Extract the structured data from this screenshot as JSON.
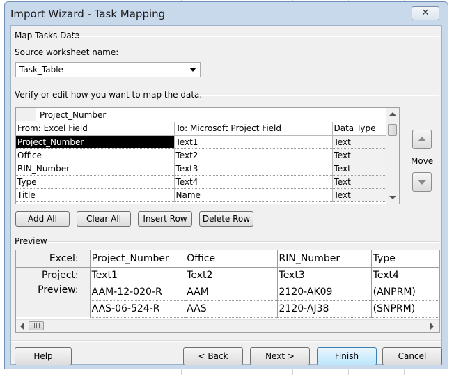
{
  "window": {
    "title": "Import Wizard - Task Mapping",
    "close_label": "✕"
  },
  "section": {
    "heading": "Map Tasks Data",
    "source_label": "Source worksheet name:",
    "source_value": "Task_Table",
    "verify_label": "Verify or edit how you want to map the data."
  },
  "mapping": {
    "edit_value": "Project_Number",
    "headers": [
      "From: Excel Field",
      "To:  Microsoft Project Field",
      "Data Type"
    ],
    "rows": [
      [
        "Project_Number",
        "Text1",
        "Text"
      ],
      [
        "Office",
        "Text2",
        "Text"
      ],
      [
        "RIN_Number",
        "Text3",
        "Text"
      ],
      [
        "Type",
        "Text4",
        "Text"
      ],
      [
        "Title",
        "Name",
        "Text"
      ]
    ],
    "selected_row": 0
  },
  "move": {
    "label": "Move"
  },
  "buttons": {
    "add_all": "Add All",
    "clear_all": "Clear All",
    "insert_row": "Insert Row",
    "delete_row": "Delete Row"
  },
  "preview": {
    "label": "Preview",
    "excel_label": "Excel:",
    "project_label": "Project:",
    "preview_label": "Preview:",
    "excel_fields": [
      "Project_Number",
      "Office",
      "RIN_Number",
      "Type"
    ],
    "project_fields": [
      "Text1",
      "Text2",
      "Text3",
      "Text4"
    ],
    "rows": [
      [
        "AAM-12-020-R",
        "AAM",
        "2120-AK09",
        "(ANPRM)"
      ],
      [
        "AAS-06-524-R",
        "AAS",
        "2120-AJ38",
        "(SNPRM)"
      ]
    ]
  },
  "footer": {
    "help": "Help",
    "back": "< Back",
    "next": "Next >",
    "finish": "Finish",
    "cancel": "Cancel"
  }
}
